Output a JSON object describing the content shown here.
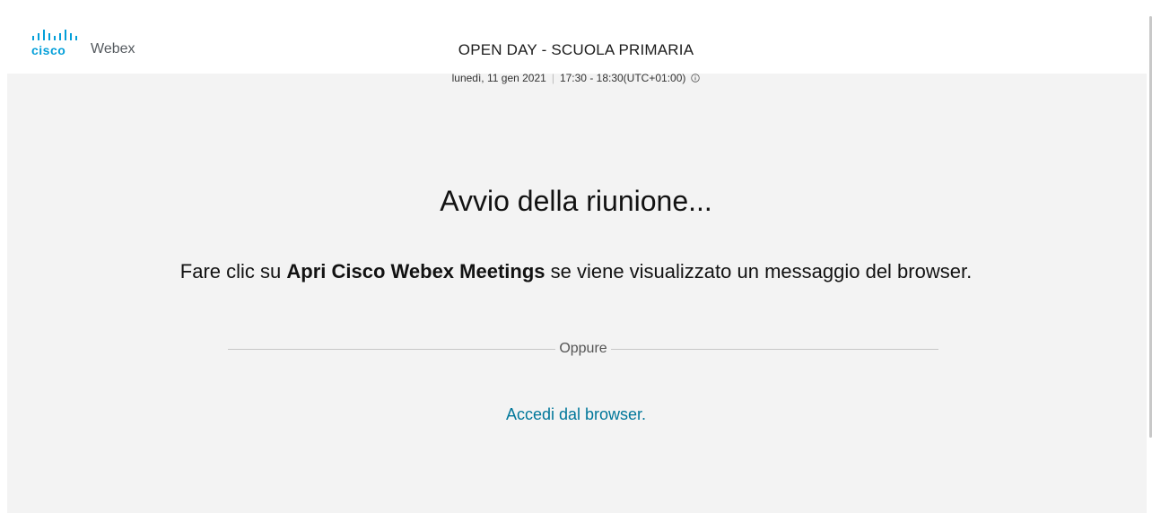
{
  "header": {
    "brand_cisco": "cisco",
    "brand_product": "Webex"
  },
  "meeting": {
    "title": "OPEN DAY - SCUOLA PRIMARIA",
    "date": "lunedì, 11 gen 2021",
    "time_separator": "|",
    "time_range": "17:30 - 18:30(UTC+01:00)",
    "info_icon": "info-circle-icon"
  },
  "launch": {
    "status": "Avvio della riunione...",
    "instruction_prefix": "Fare clic su ",
    "instruction_bold": "Apri Cisco Webex Meetings",
    "instruction_suffix": " se viene visualizzato un messaggio del browser.",
    "divider_label": "Oppure",
    "browser_link": "Accedi dal browser."
  },
  "colors": {
    "cisco_blue": "#049fd9",
    "link": "#00779a",
    "page_background": "#f3f3f3"
  }
}
